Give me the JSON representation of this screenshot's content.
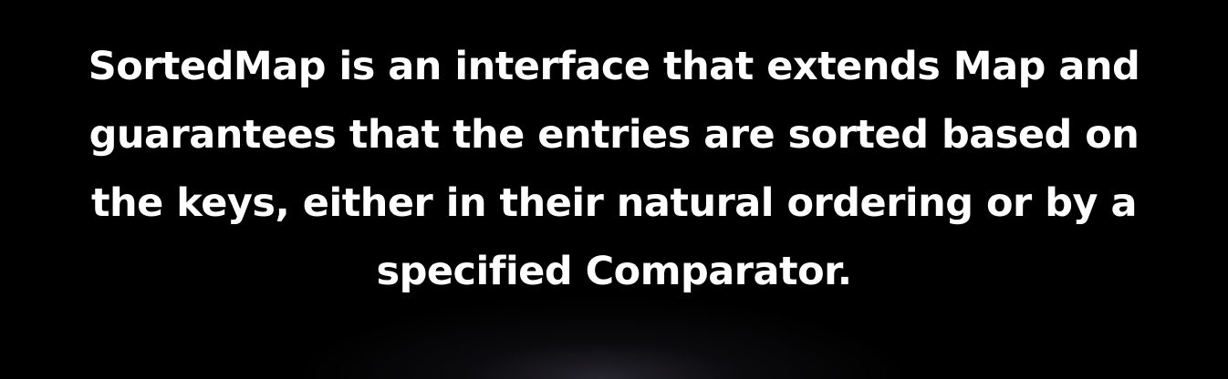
{
  "slide": {
    "background_color": "#000000",
    "text_color": "#ffffff",
    "lines": [
      "SortedMap is an interface that extends Map and",
      "guarantees that the entries are sorted based on",
      "the keys, either in their natural ordering or by a",
      "specified Comparator."
    ]
  }
}
